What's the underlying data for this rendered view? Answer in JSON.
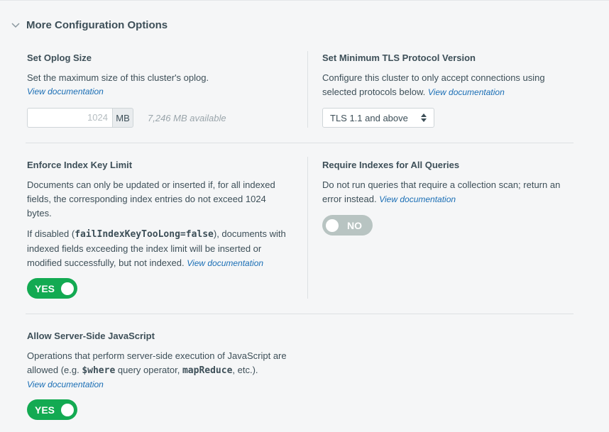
{
  "section": {
    "title": "More Configuration Options"
  },
  "oplog": {
    "title": "Set Oplog Size",
    "description": "Set the maximum size of this cluster's oplog.",
    "doc_link": "View documentation",
    "placeholder": "1024",
    "unit": "MB",
    "available": "7,246 MB available"
  },
  "tls": {
    "title": "Set Minimum TLS Protocol Version",
    "description": "Configure this cluster to only accept connections using selected protocols below.",
    "doc_link": "View documentation",
    "selected": "TLS 1.1 and above"
  },
  "index_key_limit": {
    "title": "Enforce Index Key Limit",
    "description": "Documents can only be updated or inserted if, for all indexed fields, the corresponding index entries do not exceed 1024 bytes.",
    "disabled_prefix": "If disabled (",
    "disabled_code": "failIndexKeyTooLong=false",
    "disabled_suffix": "), documents with indexed fields exceeding the index limit will be inserted or modified successfully, but not indexed.",
    "doc_link": "View documentation",
    "toggle_label": "YES"
  },
  "require_indexes": {
    "title": "Require Indexes for All Queries",
    "description": "Do not run queries that require a collection scan; return an error instead.",
    "doc_link": "View documentation",
    "toggle_label": "NO"
  },
  "server_js": {
    "title": "Allow Server-Side JavaScript",
    "desc_1": "Operations that perform server-side execution of JavaScript are allowed (e.g. ",
    "code_where": "$where",
    "desc_2": " query operator, ",
    "code_mapreduce": "mapReduce",
    "desc_3": ", etc.).",
    "doc_link": "View documentation",
    "toggle_label": "YES"
  },
  "colors": {
    "accent_link": "#1a6eb5",
    "toggle_on": "#13aa52",
    "toggle_off": "#b8c4c2"
  },
  "icons": {
    "header": "chevron-down-icon",
    "select": "sort-arrows-icon"
  }
}
